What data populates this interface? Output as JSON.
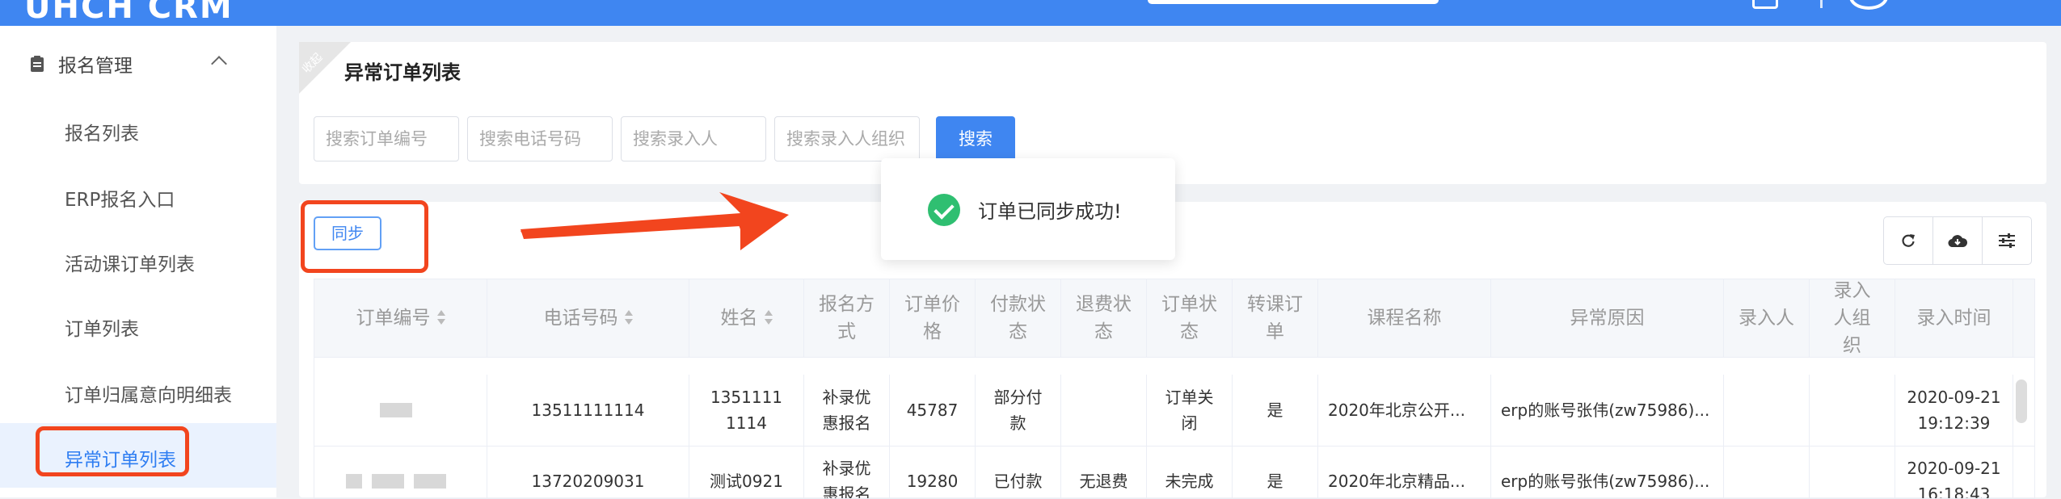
{
  "header": {
    "brand": "UHCH CRM"
  },
  "sidebar": {
    "group_label": "报名管理",
    "items": [
      {
        "label": "报名列表"
      },
      {
        "label": "ERP报名入口"
      },
      {
        "label": "活动课订单列表"
      },
      {
        "label": "订单列表"
      },
      {
        "label": "订单归属意向明细表"
      },
      {
        "label": "异常订单列表",
        "active": true
      }
    ]
  },
  "page": {
    "corner_tag": "收起",
    "title": "异常订单列表",
    "search": {
      "order_no_placeholder": "搜索订单编号",
      "phone_placeholder": "搜索电话号码",
      "entry_person_placeholder": "搜索录入人",
      "entry_org_placeholder": "搜索录入人组织",
      "button_label": "搜索"
    }
  },
  "toolbar": {
    "sync_label": "同步",
    "tools": [
      "refresh-icon",
      "cloud-download-icon",
      "sliders-icon"
    ]
  },
  "toast": {
    "message": "订单已同步成功!",
    "type": "success",
    "color": "#2fbf71"
  },
  "colors": {
    "primary": "#3f86f1",
    "annotation": "#f2451e"
  },
  "table": {
    "columns": [
      "订单编号",
      "电话号码",
      "姓名",
      "报名方式",
      "订单价格",
      "付款状态",
      "退费状态",
      "订单状态",
      "转课订单",
      "课程名称",
      "异常原因",
      "录入人",
      "录入人组织",
      "录入时间"
    ],
    "rows": [
      {
        "phone": "13511111114",
        "name": "13511111114",
        "signup_method": "补录优惠报名",
        "price": "45787",
        "payment_status": "部分付款",
        "refund_status": "",
        "order_status": "订单关闭",
        "transfer": "是",
        "course": "2020年北京公开...",
        "reason": "erp的账号张伟(zw75986)...",
        "entry_person": "",
        "entry_org": "",
        "entry_time": "2020-09-21 19:12:39"
      },
      {
        "phone": "13720209031",
        "name": "测试0921",
        "signup_method": "补录优惠报名",
        "price": "19280",
        "payment_status": "已付款",
        "refund_status": "无退费",
        "order_status": "未完成",
        "transfer": "是",
        "course": "2020年北京精品...",
        "reason": "erp的账号张伟(zw75986)...",
        "entry_person": "",
        "entry_org": "",
        "entry_time": "2020-09-21 16:18:43"
      }
    ]
  }
}
